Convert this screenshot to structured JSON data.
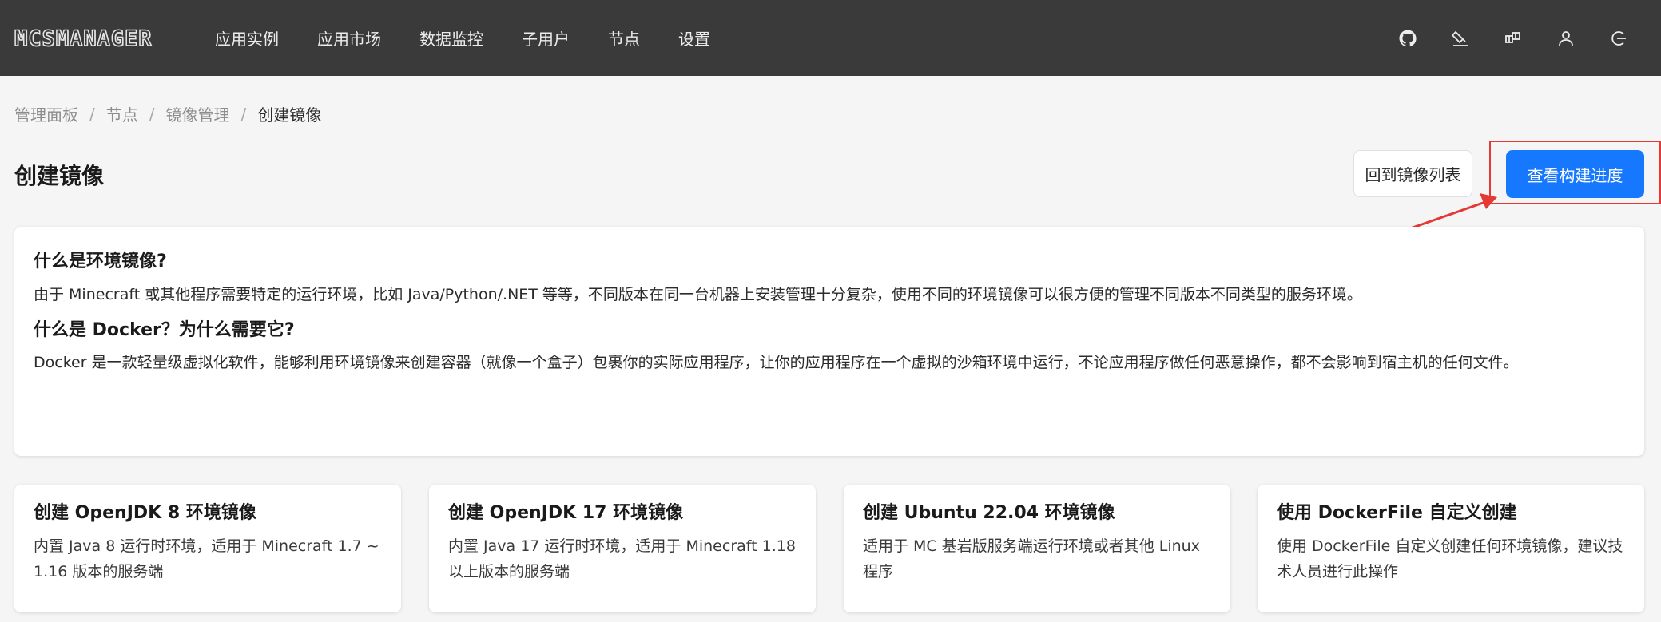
{
  "header": {
    "logo": "MCSMANAGER",
    "nav": [
      "应用实例",
      "应用市场",
      "数据监控",
      "子用户",
      "节点",
      "设置"
    ],
    "icons": [
      "github-icon",
      "theme-brush-icon",
      "layout-icon",
      "user-icon",
      "logout-icon"
    ]
  },
  "breadcrumb": [
    "管理面板",
    "节点",
    "镜像管理",
    "创建镜像"
  ],
  "breadcrumb_separator": "/",
  "page": {
    "title": "创建镜像",
    "back_button": "回到镜像列表",
    "progress_button": "查看构建进度"
  },
  "info": {
    "q1": "什么是环境镜像?",
    "a1": "由于 Minecraft 或其他程序需要特定的运行环境，比如 Java/Python/.NET 等等，不同版本在同一台机器上安装管理十分复杂，使用不同的环境镜像可以很方便的管理不同版本不同类型的服务环境。",
    "q2": "什么是 Docker？为什么需要它?",
    "a2": "Docker 是一款轻量级虚拟化软件，能够利用环境镜像来创建容器（就像一个盒子）包裹你的实际应用程序，让你的应用程序在一个虚拟的沙箱环境中运行，不论应用程序做任何恶意操作，都不会影响到宿主机的任何文件。"
  },
  "cards": [
    {
      "title": "创建 OpenJDK 8 环境镜像",
      "desc": "内置 Java 8 运行时环境，适用于 Minecraft 1.7 ~ 1.16 版本的服务端"
    },
    {
      "title": "创建 OpenJDK 17 环境镜像",
      "desc": "内置 Java 17 运行时环境，适用于 Minecraft 1.18 以上版本的服务端"
    },
    {
      "title": "创建 Ubuntu 22.04 环境镜像",
      "desc": "适用于 MC 基岩版服务端运行环境或者其他 Linux 程序"
    },
    {
      "title": "使用 DockerFile 自定义创建",
      "desc": "使用 DockerFile 自定义创建任何环境镜像，建议技术人员进行此操作"
    }
  ],
  "colors": {
    "header_bg": "#3a3a3a",
    "primary": "#1677ff",
    "annotation": "#e53935"
  }
}
